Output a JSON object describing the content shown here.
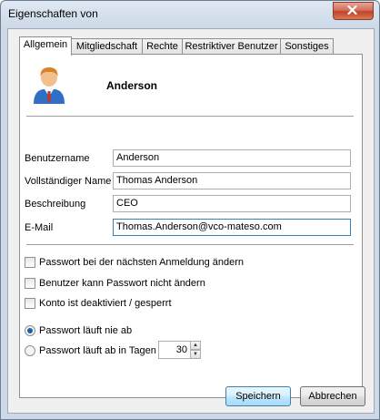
{
  "window": {
    "title": "Eigenschaften von"
  },
  "tabs": [
    {
      "label": "Allgemein",
      "active": true
    },
    {
      "label": "Mitgliedschaft",
      "active": false
    },
    {
      "label": "Rechte",
      "active": false
    },
    {
      "label": "Restriktiver Benutzer",
      "active": false
    },
    {
      "label": "Sonstiges",
      "active": false
    }
  ],
  "user": {
    "display_name": "Anderson"
  },
  "fields": {
    "benutzername": {
      "label": "Benutzername",
      "value": "Anderson"
    },
    "vollstaendiger_name": {
      "label": "Vollständiger Name",
      "value": "Thomas Anderson"
    },
    "beschreibung": {
      "label": "Beschreibung",
      "value": "CEO"
    },
    "email": {
      "label": "E-Mail",
      "value": "Thomas.Anderson@vco-mateso.com"
    }
  },
  "options": {
    "change_pw_next_login": {
      "label": "Passwort bei der nächsten Anmeldung ändern",
      "checked": false
    },
    "cannot_change_pw": {
      "label": "Benutzer kann Passwort nicht ändern",
      "checked": false
    },
    "account_disabled": {
      "label": "Konto ist deaktiviert / gesperrt",
      "checked": false
    }
  },
  "expiry": {
    "never": {
      "label": "Passwort läuft nie ab",
      "selected": true
    },
    "after_days": {
      "label": "Passwort läuft ab in Tagen",
      "selected": false,
      "days": "30"
    }
  },
  "buttons": {
    "save": "Speichern",
    "cancel": "Abbrechen"
  },
  "colors": {
    "accent": "#3c7fb1",
    "close_button": "#c2432b",
    "frame": "#cdd9e8"
  }
}
